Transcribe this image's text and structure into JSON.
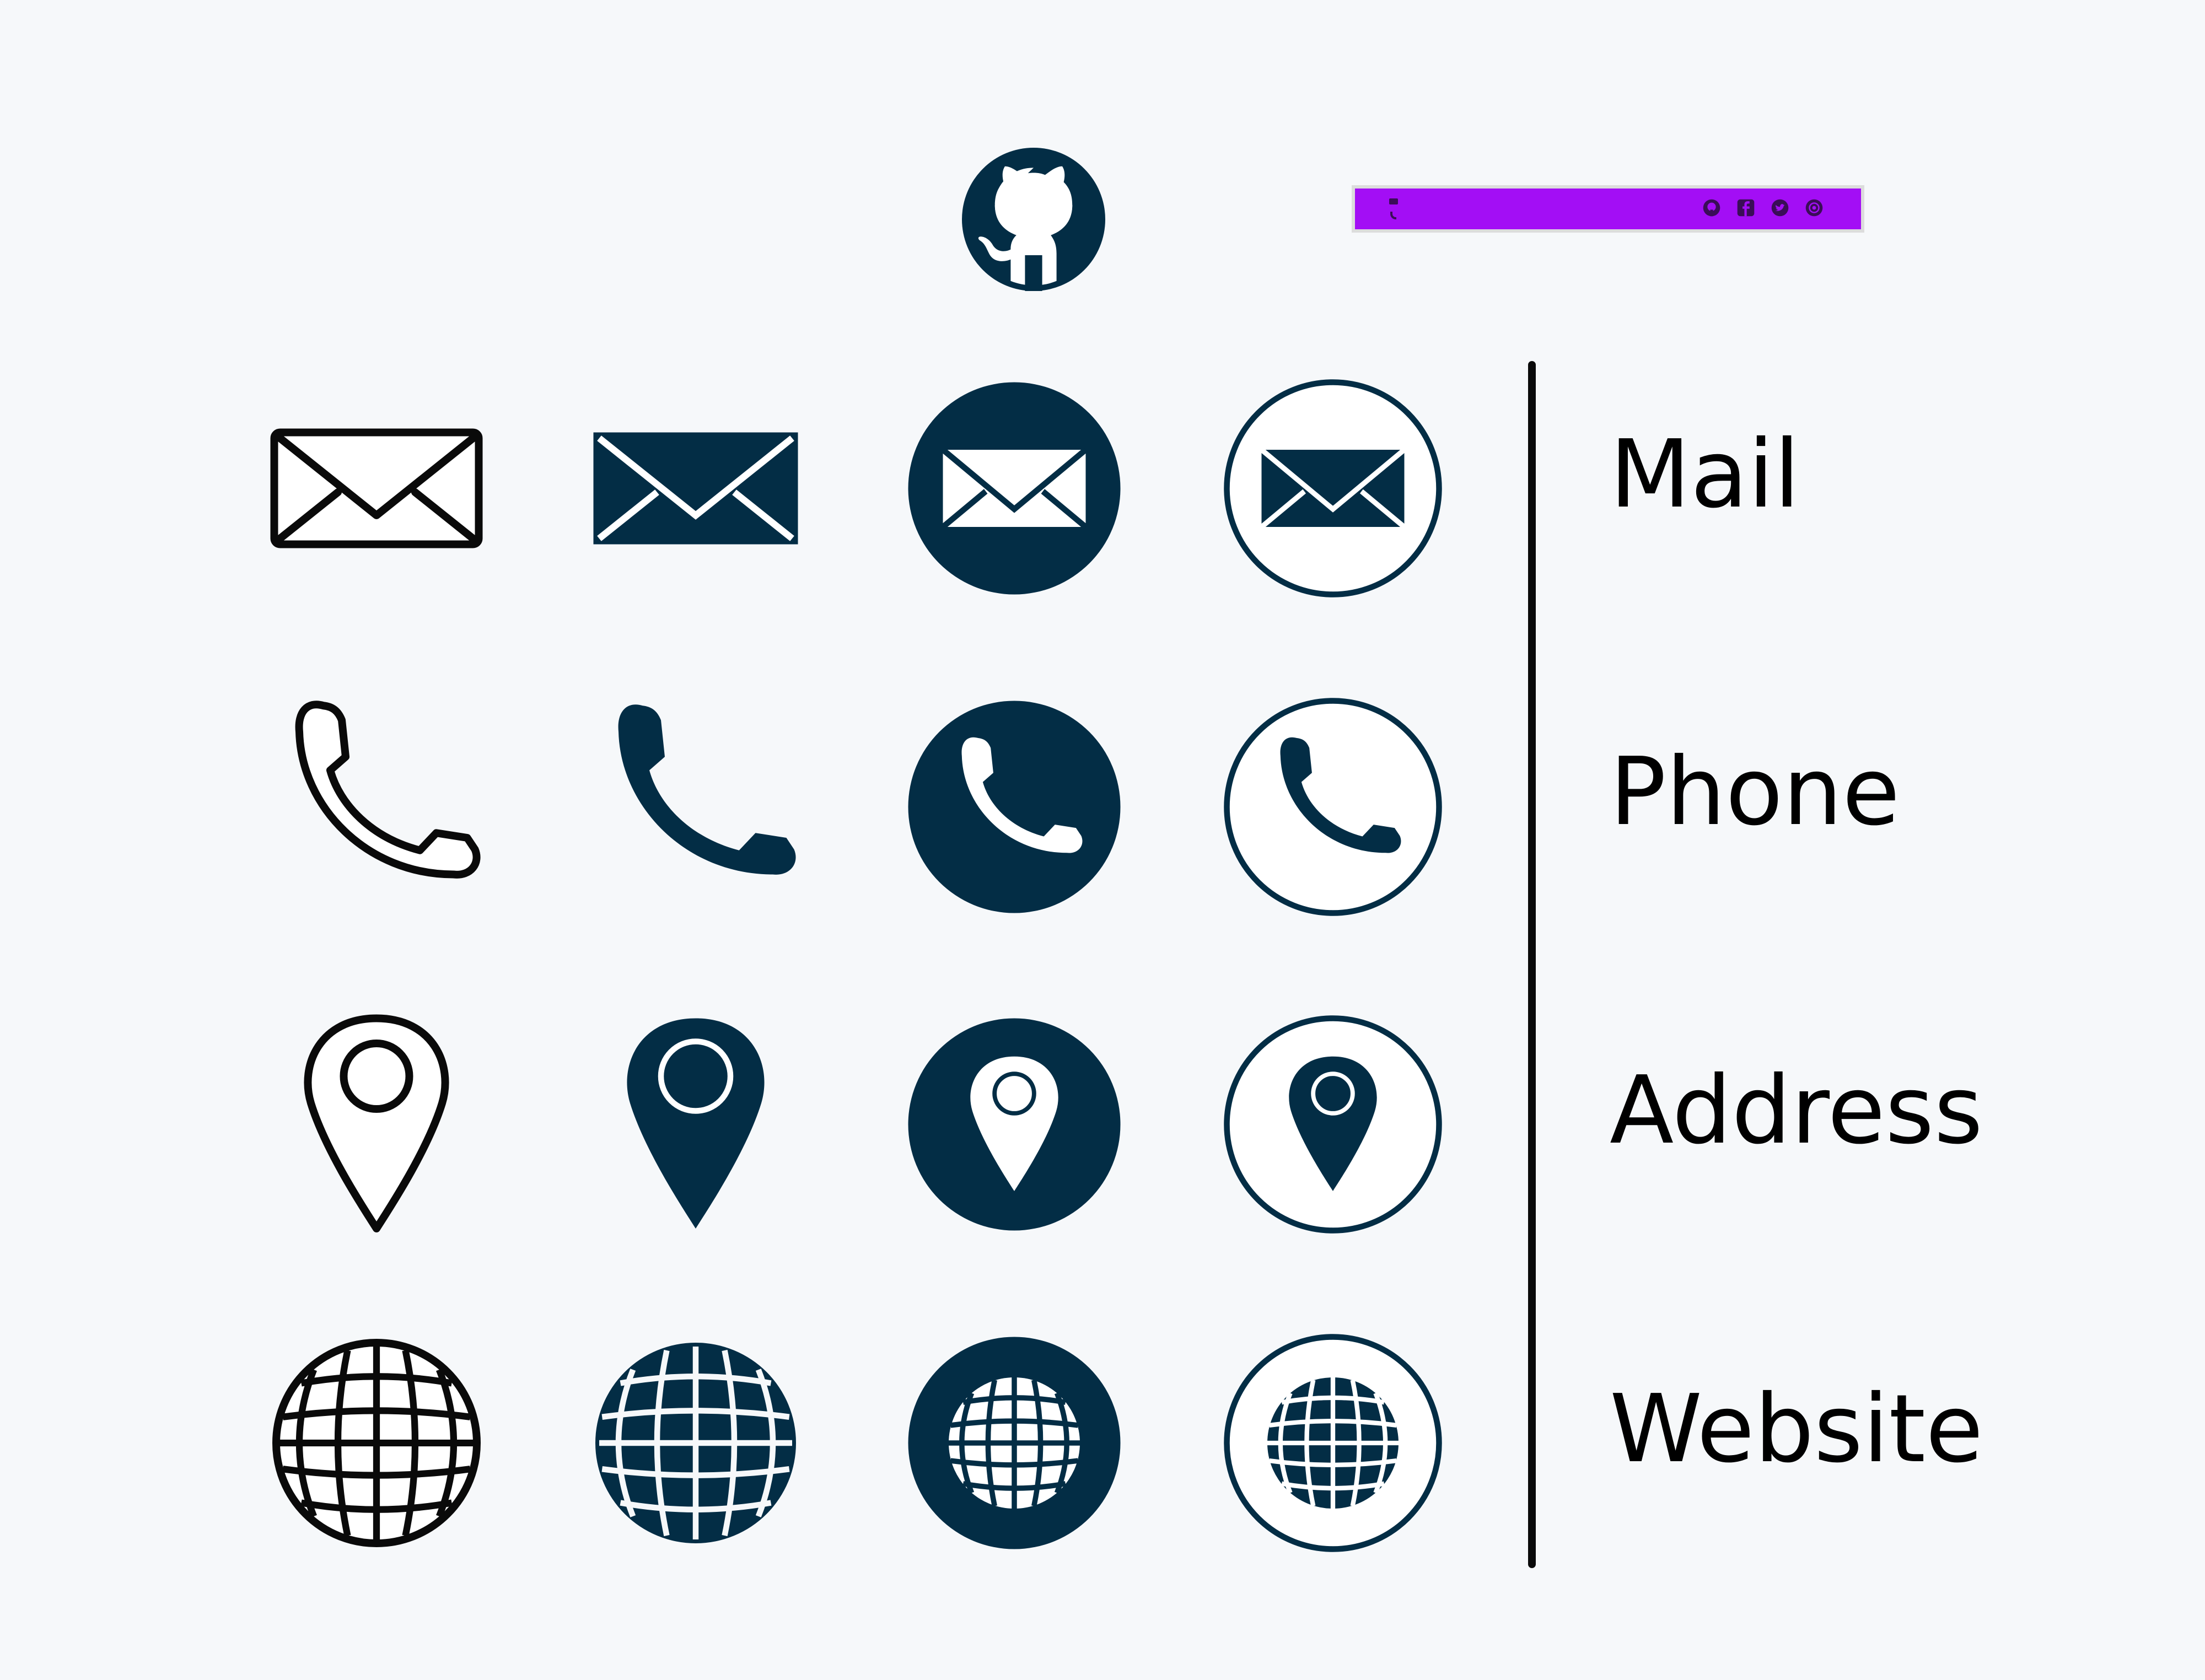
{
  "colors": {
    "background": "#f6f8fa",
    "navy": "#032d45",
    "outline": "#0a0a0a",
    "bar": "#a30ef5"
  },
  "header": {
    "github_icon": "github-octocat-icon",
    "contact_bar": {
      "rows": [
        {
          "icon": "mail-icon",
          "text": ""
        },
        {
          "icon": "phone-icon",
          "text": ""
        }
      ],
      "social_icons": [
        "github-icon",
        "facebook-icon",
        "twitter-icon",
        "whatsapp-icon"
      ]
    }
  },
  "rows": [
    {
      "label": "Mail",
      "icon": "mail-icon",
      "variants": [
        "outline",
        "filled",
        "circle-filled",
        "circle-outlined"
      ]
    },
    {
      "label": "Phone",
      "icon": "phone-icon",
      "variants": [
        "outline",
        "filled",
        "circle-filled",
        "circle-outlined"
      ]
    },
    {
      "label": "Address",
      "icon": "location-pin-icon",
      "variants": [
        "outline",
        "filled",
        "circle-filled",
        "circle-outlined"
      ]
    },
    {
      "label": "Website",
      "icon": "globe-icon",
      "variants": [
        "outline",
        "filled",
        "circle-filled",
        "circle-outlined"
      ]
    }
  ]
}
